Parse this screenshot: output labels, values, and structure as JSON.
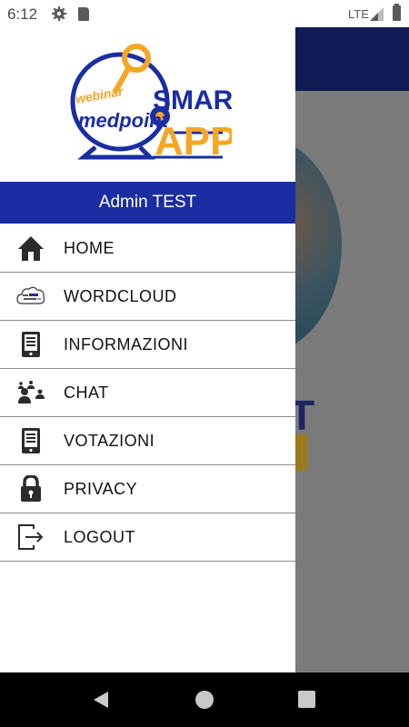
{
  "status_bar": {
    "time": "6:12",
    "network": "LTE",
    "icons": [
      "gear-icon",
      "sd-card-icon",
      "signal-icon",
      "battery-icon"
    ]
  },
  "background_app": {
    "title_fragment": "NT",
    "text_fragment": "T"
  },
  "drawer": {
    "logo": {
      "webinar": "webinar",
      "medpoint": "medpoint",
      "smart": "SMART",
      "app": "APP",
      "colors": {
        "blue": "#1a2da3",
        "orange": "#f5a623"
      }
    },
    "user_name": "Admin TEST",
    "user_bar_color": "#1a2da3",
    "menu": [
      {
        "label": "HOME",
        "icon": "home-icon"
      },
      {
        "label": "WORDCLOUD",
        "icon": "wordcloud-icon"
      },
      {
        "label": "INFORMAZIONI",
        "icon": "tablet-info-icon"
      },
      {
        "label": "CHAT",
        "icon": "people-chat-icon"
      },
      {
        "label": "VOTAZIONI",
        "icon": "tablet-vote-icon"
      },
      {
        "label": "PRIVACY",
        "icon": "lock-icon"
      },
      {
        "label": "LOGOUT",
        "icon": "logout-icon"
      }
    ]
  },
  "nav_bar": {
    "icons": [
      "back-icon",
      "home-circle-icon",
      "recents-icon"
    ]
  }
}
